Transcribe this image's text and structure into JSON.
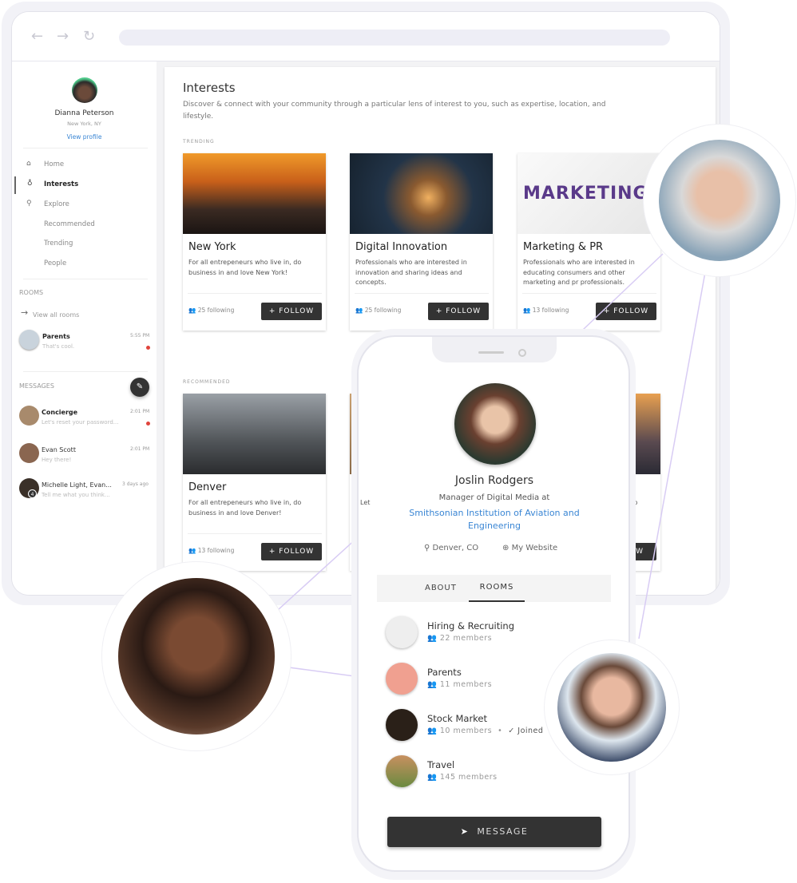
{
  "browser": {
    "back_icon": "arrow-left-icon",
    "forward_icon": "arrow-right-icon",
    "reload_icon": "reload-icon"
  },
  "sidebar": {
    "user": {
      "name": "Dianna Peterson",
      "location": "New York, NY",
      "view_profile": "View profile"
    },
    "nav": [
      {
        "label": "Home",
        "icon": "home-icon"
      },
      {
        "label": "Interests",
        "icon": "lightbulb-icon",
        "active": true
      },
      {
        "label": "Explore",
        "icon": "search-icon"
      },
      {
        "label": "Recommended"
      },
      {
        "label": "Trending"
      },
      {
        "label": "People"
      }
    ],
    "rooms_heading": "ROOMS",
    "view_all_rooms": "View all rooms",
    "rooms": [
      {
        "name": "Parents",
        "preview": "That's cool.",
        "time": "5:55 PM",
        "unread": true
      }
    ],
    "messages_heading": "MESSAGES",
    "messages": [
      {
        "name": "Concierge",
        "preview": "Let's reset your password...",
        "time": "2:01 PM",
        "unread": true,
        "bold": true
      },
      {
        "name": "Evan Scott",
        "preview": "Hey there!",
        "time": "2:01 PM",
        "unread": false
      },
      {
        "name": "Michelle Light, Evan...",
        "preview": "Tell me what you think...",
        "time": "3 days ago",
        "badge": "4"
      }
    ]
  },
  "main": {
    "title": "Interests",
    "description": "Discover & connect with your community through a particular lens of interest to you, such as expertise, location, and lifestyle.",
    "trending_heading": "TRENDING",
    "recommended_heading": "RECOMMENDED",
    "follow_label": "FOLLOW",
    "trending": [
      {
        "title": "New York",
        "description": "For all entrepeneurs who live in, do business in and love New York!",
        "following": "25 following"
      },
      {
        "title": "Digital Innovation",
        "description": "Professionals who are interested in innovation and sharing ideas and concepts.",
        "following": "25 following"
      },
      {
        "title": "Marketing & PR",
        "description": "Professionals who are interested in educating consumers and other marketing and pr professionals.",
        "following": "13 following",
        "image_text": "MARKETING"
      }
    ],
    "recommended": [
      {
        "title": "Denver",
        "description": "For all entrepeneurs who live in, do business in and love Denver!",
        "following": "13 following"
      },
      {
        "title": "M",
        "description": "Let"
      },
      {
        "description": "in, do"
      }
    ]
  },
  "profile": {
    "name": "Joslin Rodgers",
    "role": "Manager of Digital Media at",
    "org": "Smithsonian Institution of Aviation and Engineering",
    "location": "Denver, CO",
    "website": "My Website",
    "tabs": [
      "ABOUT",
      "ROOMS"
    ],
    "active_tab": "ROOMS",
    "rooms": [
      {
        "name": "Hiring & Recruiting",
        "members": "22 members"
      },
      {
        "name": "Parents",
        "members": "11 members"
      },
      {
        "name": "Stock Market",
        "members": "10 members",
        "joined": "Joined"
      },
      {
        "name": "Travel",
        "members": "145 members"
      }
    ],
    "message_button": "MESSAGE"
  },
  "colors": {
    "accent": "#3a86d4",
    "dark": "#333333",
    "unread": "#e0443c",
    "line": "#d8ccf4"
  }
}
